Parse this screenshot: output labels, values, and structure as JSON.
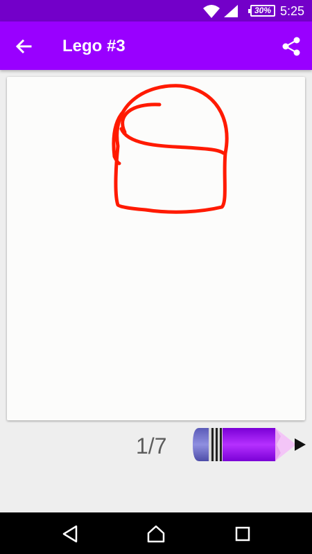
{
  "status_bar": {
    "battery_percent": "30%",
    "time": "5:25",
    "icons": [
      "wifi-icon",
      "signal-icon",
      "battery-icon"
    ]
  },
  "toolbar": {
    "title": "Lego #3",
    "back_icon": "arrow-left-icon",
    "share_icon": "share-icon",
    "background_color": "#9900ff"
  },
  "drawing": {
    "stroke_color": "#ff1a00",
    "step": "1/7"
  },
  "nav_bar": {
    "icons": [
      "back-triangle-icon",
      "home-icon",
      "recents-square-icon"
    ]
  }
}
